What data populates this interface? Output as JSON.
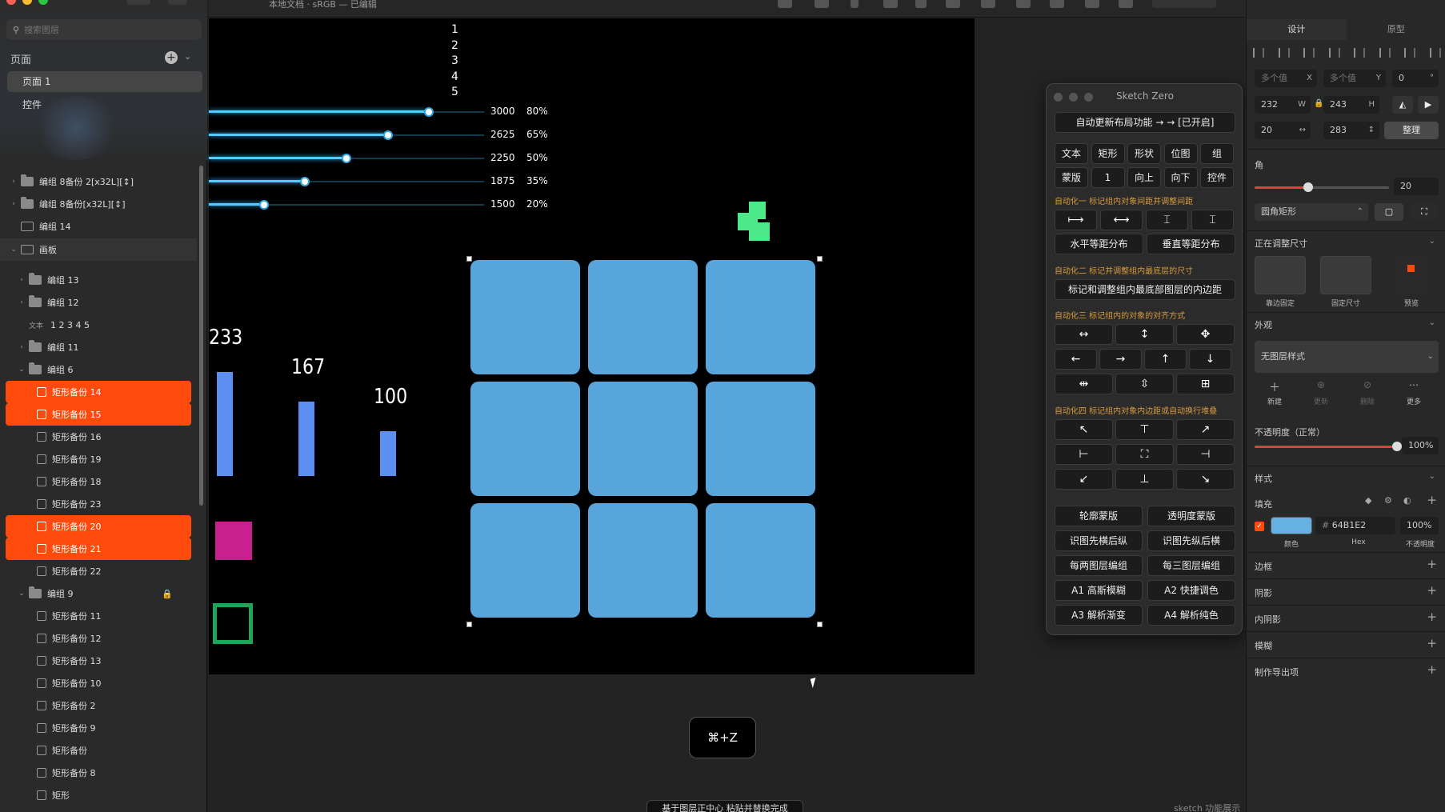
{
  "window": {
    "title": "本地文档 · sRGB — 已编辑"
  },
  "colors": {
    "accent": "#ff4a0e",
    "tile": "#57a5db",
    "bar": "#5b8ff2",
    "slider": "#55ccff",
    "magenta": "#c9208f",
    "green": "#20a45a",
    "mint": "#4de88a",
    "fill_hex": "#64B1E2"
  },
  "sidebar": {
    "search_placeholder": "搜索图层",
    "pages_heading": "页面",
    "pages": [
      "页面 1",
      "控件"
    ],
    "layers": [
      {
        "label": "编组 8备份 2[x32L][↕]",
        "kind": "folder",
        "indent": 0,
        "chev": "›"
      },
      {
        "label": "编组 8备份[x32L][↕]",
        "kind": "folder",
        "indent": 0,
        "chev": "›"
      },
      {
        "label": "编组 14",
        "kind": "image",
        "indent": 0,
        "chev": ""
      },
      {
        "label": "画板",
        "kind": "artboard",
        "indent": 0,
        "chev": "⌄"
      },
      {
        "label": "编组 13",
        "kind": "folder",
        "indent": 1,
        "chev": "›"
      },
      {
        "label": "编组 12",
        "kind": "folder",
        "indent": 1,
        "chev": "›"
      },
      {
        "label": "1 2 3 4 5",
        "kind": "text",
        "indent": 1,
        "chev": ""
      },
      {
        "label": "编组 11",
        "kind": "folder",
        "indent": 1,
        "chev": "›"
      },
      {
        "label": "编组 6",
        "kind": "folder",
        "indent": 1,
        "chev": "⌄"
      },
      {
        "label": "矩形备份 14",
        "kind": "rect",
        "indent": 2,
        "chev": ""
      },
      {
        "label": "矩形备份 15",
        "kind": "rect",
        "indent": 2,
        "chev": ""
      },
      {
        "label": "矩形备份 16",
        "kind": "rect",
        "indent": 2,
        "chev": ""
      },
      {
        "label": "矩形备份 19",
        "kind": "rect",
        "indent": 2,
        "chev": ""
      },
      {
        "label": "矩形备份 18",
        "kind": "rect",
        "indent": 2,
        "chev": ""
      },
      {
        "label": "矩形备份 23",
        "kind": "rect",
        "indent": 2,
        "chev": ""
      },
      {
        "label": "矩形备份 20",
        "kind": "rect",
        "indent": 2,
        "chev": ""
      },
      {
        "label": "矩形备份 21",
        "kind": "rect",
        "indent": 2,
        "chev": ""
      },
      {
        "label": "矩形备份 22",
        "kind": "rect",
        "indent": 2,
        "chev": ""
      },
      {
        "label": "编组 9",
        "kind": "folder",
        "indent": 1,
        "chev": "⌄"
      },
      {
        "label": "矩形备份 11",
        "kind": "rect",
        "indent": 2,
        "chev": ""
      },
      {
        "label": "矩形备份 12",
        "kind": "rect",
        "indent": 2,
        "chev": ""
      },
      {
        "label": "矩形备份 13",
        "kind": "rect",
        "indent": 2,
        "chev": ""
      },
      {
        "label": "矩形备份 10",
        "kind": "rect",
        "indent": 2,
        "chev": ""
      },
      {
        "label": "矩形备份 2",
        "kind": "rect",
        "indent": 2,
        "chev": ""
      },
      {
        "label": "矩形备份 9",
        "kind": "rect",
        "indent": 2,
        "chev": ""
      },
      {
        "label": "矩形备份",
        "kind": "rect",
        "indent": 2,
        "chev": ""
      },
      {
        "label": "矩形备份 8",
        "kind": "rect",
        "indent": 2,
        "chev": ""
      },
      {
        "label": "矩形",
        "kind": "rect",
        "indent": 2,
        "chev": ""
      }
    ],
    "text_kind_label": "文本"
  },
  "canvas": {
    "numbers": [
      "1",
      "2",
      "3",
      "4",
      "5"
    ],
    "sliders": [
      {
        "value": "3000",
        "percent": "80%",
        "fraction": 0.8
      },
      {
        "value": "2625",
        "percent": "65%",
        "fraction": 0.65
      },
      {
        "value": "2250",
        "percent": "50%",
        "fraction": 0.5
      },
      {
        "value": "1875",
        "percent": "35%",
        "fraction": 0.35
      },
      {
        "value": "1500",
        "percent": "20%",
        "fraction": 0.2
      }
    ],
    "bars": [
      {
        "label": "233",
        "value": 233
      },
      {
        "label": "167",
        "value": 167
      },
      {
        "label": "100",
        "value": 100
      }
    ],
    "undo_hint": "⌘+Z",
    "toast": "基于图层正中心 粘贴并替换完成",
    "watermark": "sketch 功能展示"
  },
  "plugin": {
    "title": "Sketch Zero",
    "auto_update": "自动更新布局功能 → → [已开启]",
    "row1": [
      "文本",
      "矩形",
      "形状",
      "位图",
      "组"
    ],
    "row2": [
      "蒙版",
      "1",
      "向上",
      "向下",
      "控件"
    ],
    "sec1": "自动化一 标记组内对象间距并调整间距",
    "spacing_icons": [
      "⟼",
      "⟷",
      "⌶",
      "⌶"
    ],
    "distribute": [
      "水平等距分布",
      "垂直等距分布"
    ],
    "sec2": "自动化二 标记并调整组内最底层的尺寸",
    "padding_btn": "标记和调整组内最底部图层的内边距",
    "sec3": "自动化三 标记组内的对象的对齐方式",
    "align_icons": [
      "↔",
      "↕",
      "✥",
      "←",
      "→",
      "↑",
      "↓",
      "⇹",
      "⇳",
      "⊞"
    ],
    "sec4": "自动化四 标记组内对象内边距或自动换行堆叠",
    "pos_icons": [
      "↖",
      "⊤",
      "↗",
      "⊢",
      "⛶",
      "⊣",
      "↙",
      "⊥",
      "↘"
    ],
    "actions": [
      "轮廓蒙版",
      "透明度蒙版",
      "识图先横后纵",
      "识图先纵后横",
      "每两图层编组",
      "每三图层编组",
      "A1 高斯模糊",
      "A2 快捷调色",
      "A3 解析渐变",
      "A4 解析纯色"
    ]
  },
  "inspector": {
    "tabs": [
      "设计",
      "原型"
    ],
    "x_value": "多个值",
    "x_label": "X",
    "y_value": "多个值",
    "y_label": "Y",
    "rotation": "0",
    "rotation_unit": "°",
    "w_value": "232",
    "w_label": "W",
    "h_value": "243",
    "h_label": "H",
    "spacing_value": "20",
    "spacing_icon": "↔",
    "spacing2_value": "283",
    "spacing2_icon": "↕",
    "tidy_label": "整理",
    "corner_heading": "角",
    "corner_value": "20",
    "corner_fraction": 0.4,
    "corner_style": "圆角矩形",
    "resizing_heading": "正在调整尺寸",
    "resizing_options": [
      "靠边固定",
      "固定尺寸",
      "预览"
    ],
    "appearance_heading": "外观",
    "layer_style": "无图层样式",
    "style_actions": [
      "新建",
      "更新",
      "删除",
      "更多"
    ],
    "opacity_label": "不透明度（正常）",
    "opacity_value": "100%",
    "opacity_fraction": 1.0,
    "style_heading": "样式",
    "fill_heading": "填充",
    "fill_hex": "64B1E2",
    "fill_hash": "#",
    "fill_opacity": "100%",
    "fill_captions": [
      "颜色",
      "Hex",
      "不透明度"
    ],
    "sections": [
      "边框",
      "阴影",
      "内阴影",
      "模糊",
      "制作导出项"
    ]
  }
}
